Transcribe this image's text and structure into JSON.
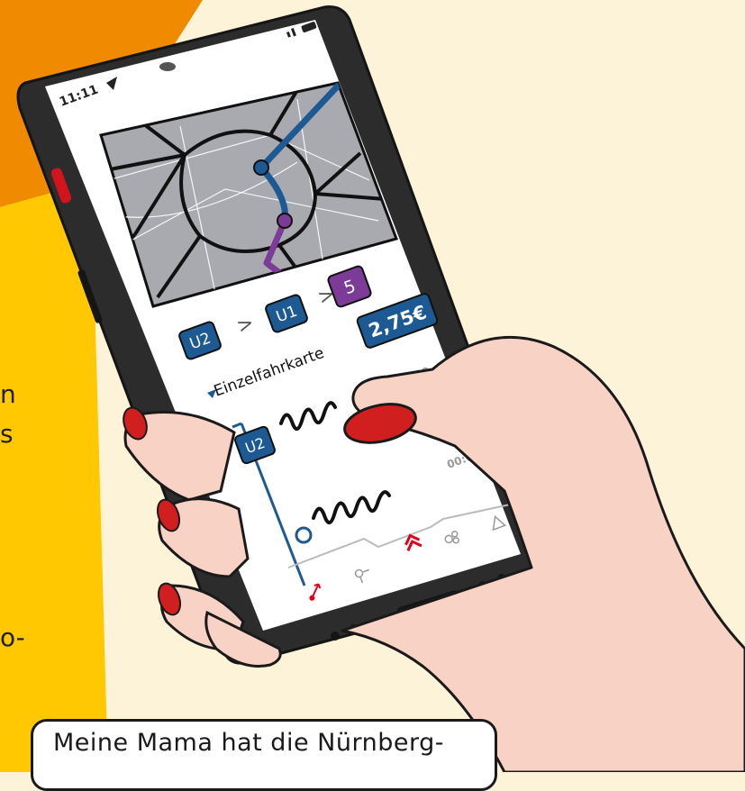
{
  "status_bar": {
    "time": "11:11"
  },
  "route": {
    "segments": [
      {
        "label": "U2",
        "color": "#1d5a93"
      },
      {
        "label": "U1",
        "color": "#1d5a93"
      },
      {
        "label": "5",
        "color": "#7b3b97"
      }
    ],
    "separator": ">"
  },
  "ticket": {
    "name": "Einzelfahrkarte",
    "price": "2,75€",
    "time_placeholder_1": "00:00",
    "time_placeholder_2": "00:00"
  },
  "journey": {
    "line": "U2"
  },
  "bottom_nav": {
    "items": [
      {
        "icon": "route-icon"
      },
      {
        "icon": "directions-icon"
      },
      {
        "icon": "home-chevron-icon"
      },
      {
        "icon": "network-icon"
      },
      {
        "icon": "warning-icon"
      }
    ]
  },
  "caption": {
    "text": "Meine Mama hat die Nürnberg-"
  },
  "side_text": {
    "frag1": "n",
    "frag2": "s",
    "frag3": "o-"
  },
  "colors": {
    "background": "#fdf3d9",
    "orange": "#f08a00",
    "yellow": "#ffc800",
    "u_line_blue": "#1d5a93",
    "tram_purple": "#7b3b97",
    "accent_red": "#e2001a",
    "skin": "#f8d2c4",
    "nail": "#d11f1f"
  }
}
